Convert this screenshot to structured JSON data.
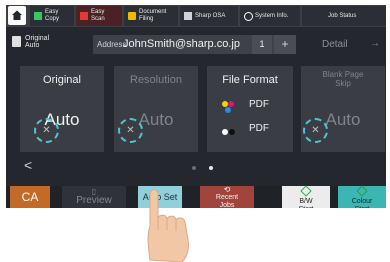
{
  "topbar": {
    "tabs": [
      {
        "line1": "Easy",
        "line2": "Copy",
        "icon": "copy-icon",
        "color": "#34c759"
      },
      {
        "line1": "Easy",
        "line2": "Scan",
        "icon": "scan-icon",
        "color": "#e53935"
      },
      {
        "line1": "Document",
        "line2": "Filing",
        "icon": "filing-icon",
        "color": "#f5b800"
      },
      {
        "line1": "",
        "line2": "Sharp OSA",
        "icon": "osa-icon",
        "color": "#9aa0a6"
      },
      {
        "line1": "",
        "line2": "System Info.",
        "icon": "info-icon",
        "color": "#ffffff"
      },
      {
        "line1": "",
        "line2": "Job Status",
        "icon": "",
        "color": ""
      }
    ]
  },
  "row2": {
    "original_label": "Original\nAuto",
    "address_label": "Address",
    "address_value": "JohnSmith@sharp.co.jp",
    "address_count": "1",
    "add_symbol": "+",
    "detail_label": "Detail",
    "detail_arrow": "→"
  },
  "cards": {
    "original": {
      "title": "Original",
      "value": "Auto"
    },
    "resolution": {
      "title": "Resolution",
      "value": "Auto"
    },
    "file_format": {
      "title": "File Format",
      "row1": "PDF",
      "row2": "PDF"
    },
    "blank_page": {
      "title": "Blank Page\nSkip",
      "value": "Auto"
    }
  },
  "pager": {
    "prev_symbol": "<"
  },
  "bottom": {
    "ca_label": "CA",
    "preview_label": "Preview",
    "autoset_label": "Auto Set",
    "recent_label": "Recent\nJobs",
    "bw_label": "B/W\nStart",
    "colour_label": "Colour\nStart"
  },
  "colors": {
    "accent_touch": "#4fc5d3",
    "ca": "#c46a28",
    "recent": "#a1443c",
    "colour_start": "#3bb6b2",
    "autoset": "#8fd0db"
  }
}
